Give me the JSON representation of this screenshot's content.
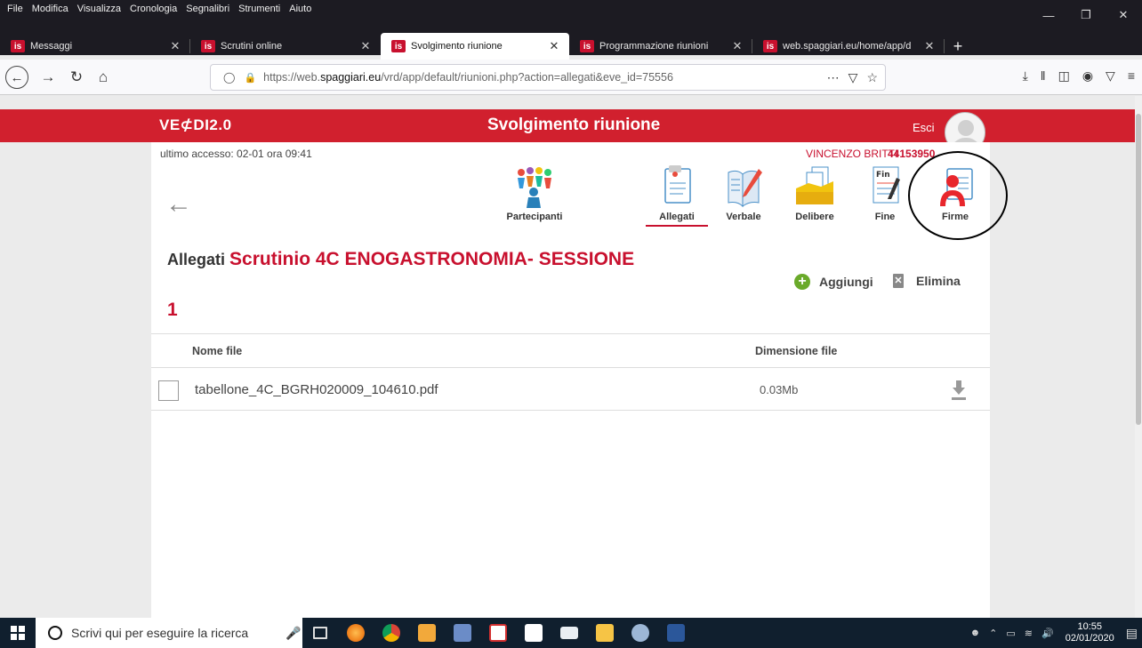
{
  "browser": {
    "menu": [
      "File",
      "Modifica",
      "Visualizza",
      "Cronologia",
      "Segnalibri",
      "Strumenti",
      "Aiuto"
    ],
    "tabs": [
      {
        "label": "Messaggi",
        "active": false
      },
      {
        "label": "Scrutini online",
        "active": false
      },
      {
        "label": "Svolgimento riunione",
        "active": true
      },
      {
        "label": "Programmazione riunioni",
        "active": false
      },
      {
        "label": "web.spaggiari.eu/home/app/d",
        "active": false
      }
    ],
    "tab_favicon": "is",
    "url_prefix": "https://web.",
    "url_domain": "spaggiari.eu",
    "url_path": "/vrd/app/default/riunioni.php?action=allegati&eve_id=75556"
  },
  "header": {
    "logo": "VE⊄DI2.0",
    "title": "Svolgimento riunione",
    "logout": "Esci",
    "last_access": "ultimo accesso: 02-01 ora 09:41",
    "user_name": "VINCENZO BRITTI",
    "user_id": "44153950"
  },
  "nav": {
    "items": [
      {
        "label": "Partecipanti",
        "icon": "participants-icon"
      },
      {
        "label": "Allegati",
        "icon": "attachments-icon",
        "active": true
      },
      {
        "label": "Verbale",
        "icon": "minutes-icon"
      },
      {
        "label": "Delibere",
        "icon": "resolutions-icon"
      },
      {
        "label": "Fine",
        "icon": "end-icon"
      },
      {
        "label": "Firme",
        "icon": "signatures-icon"
      }
    ]
  },
  "section": {
    "prefix": "Allegati",
    "title": "Scrutinio 4C ENOGASTRONOMIA- SESSIONE",
    "title_line2": "1",
    "add_label": "Aggiungi",
    "delete_label": "Elimina"
  },
  "table": {
    "columns": [
      "Nome file",
      "Dimensione file"
    ],
    "rows": [
      {
        "name": "tabellone_4C_BGRH020009_104610.pdf",
        "size": "0.03Mb"
      }
    ]
  },
  "taskbar": {
    "search_placeholder": "Scrivi qui per eseguire la ricerca",
    "time": "10:55",
    "date": "02/01/2020"
  },
  "colors": {
    "brand_red": "#d1202e",
    "accent_green": "#6aaa2a"
  }
}
